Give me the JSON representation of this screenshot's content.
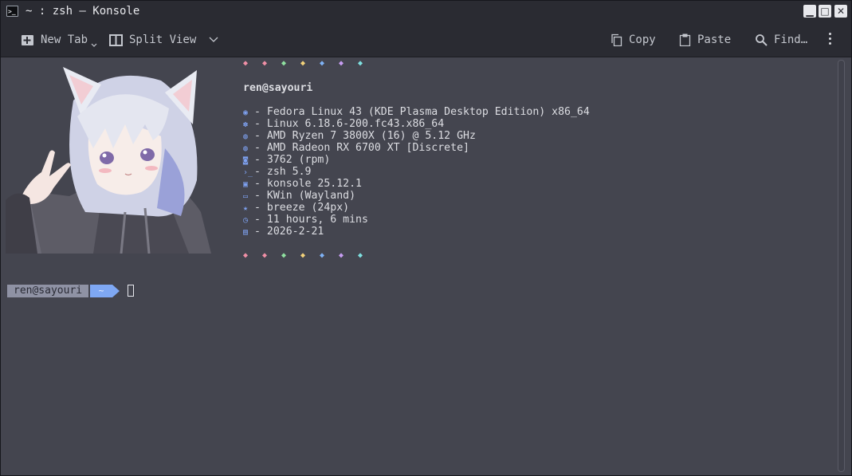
{
  "window": {
    "title": "~ : zsh — Konsole",
    "app_icon_glyph": ">_",
    "controls": {
      "minimize": "▁",
      "maximize": "□",
      "close": "✕"
    }
  },
  "toolbar": {
    "new_tab": "New Tab",
    "split_view": "Split View",
    "copy": "Copy",
    "paste": "Paste",
    "find": "Find…"
  },
  "terminal": {
    "header_user": "ren@sayouri",
    "info_lines": [
      {
        "icon": "distro-icon",
        "glyph": "◉",
        "text": "- Fedora Linux 43 (KDE Plasma Desktop Edition) x86_64"
      },
      {
        "icon": "kernel-icon",
        "glyph": "✽",
        "text": "- Linux 6.18.6-200.fc43.x86_64"
      },
      {
        "icon": "cpu-icon",
        "glyph": "◍",
        "text": "- AMD Ryzen 7 3800X (16) @ 5.12 GHz"
      },
      {
        "icon": "gpu-icon",
        "glyph": "◍",
        "text": "- AMD Radeon RX 6700 XT [Discrete]"
      },
      {
        "icon": "package-icon",
        "glyph": "◙",
        "text": "- 3762 (rpm)"
      },
      {
        "icon": "shell-icon",
        "glyph": "›_",
        "text": "- zsh 5.9"
      },
      {
        "icon": "terminal-icon",
        "glyph": "▣",
        "text": "- konsole 25.12.1"
      },
      {
        "icon": "window-manager-icon",
        "glyph": "▭",
        "text": "- KWin (Wayland)"
      },
      {
        "icon": "theme-icon",
        "glyph": "★",
        "text": "- breeze (24px)"
      },
      {
        "icon": "uptime-icon",
        "glyph": "◷",
        "text": "- 11 hours, 6 mins"
      },
      {
        "icon": "calendar-icon",
        "glyph": "▤",
        "text": "- 2026-2-21"
      }
    ],
    "cat_row": [
      {
        "glyph": "◆",
        "color": "#f08fa6"
      },
      {
        "glyph": "◆",
        "color": "#f08fa6"
      },
      {
        "glyph": "◆",
        "color": "#8fe0a0"
      },
      {
        "glyph": "◆",
        "color": "#f3d27a"
      },
      {
        "glyph": "◆",
        "color": "#7fb2f5"
      },
      {
        "glyph": "◆",
        "color": "#c79df2"
      },
      {
        "glyph": "◆",
        "color": "#7fe0e0"
      }
    ],
    "prompt_user": "ren@sayouri",
    "prompt_dir": "~"
  },
  "colors": {
    "background": "#44454f",
    "titlebar": "#2a2b32",
    "accent": "#7fa8f4"
  }
}
